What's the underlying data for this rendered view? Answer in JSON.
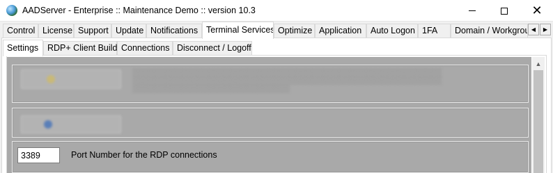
{
  "window": {
    "title": "AADServer - Enterprise :: Maintenance Demo :: version 10.3",
    "close_glyph": "✕"
  },
  "main_tabs": [
    {
      "label": "Control"
    },
    {
      "label": "License"
    },
    {
      "label": "Support"
    },
    {
      "label": "Update"
    },
    {
      "label": "Notifications"
    },
    {
      "label": "Terminal Services",
      "active": true
    },
    {
      "label": "Optimize"
    },
    {
      "label": "Application"
    },
    {
      "label": "Auto Logon"
    },
    {
      "label": "1FA"
    },
    {
      "label": "Domain / Workgroup"
    }
  ],
  "tab_scroll": {
    "left_glyph": "◀",
    "right_glyph": "▶"
  },
  "sub_tabs": [
    {
      "label": "Settings",
      "active": true
    },
    {
      "label": "RDP+ Client Build"
    },
    {
      "label": "Connections"
    },
    {
      "label": "Disconnect / Logoff"
    }
  ],
  "settings": {
    "port_value": "3389",
    "port_label": "Port Number for the RDP connections"
  },
  "scrollbar": {
    "up_glyph": "▲"
  },
  "colors": {
    "panel_grey": "#a9a9a9",
    "window_bg": "#f0f0f0",
    "tab_border": "#d9d9d9"
  }
}
